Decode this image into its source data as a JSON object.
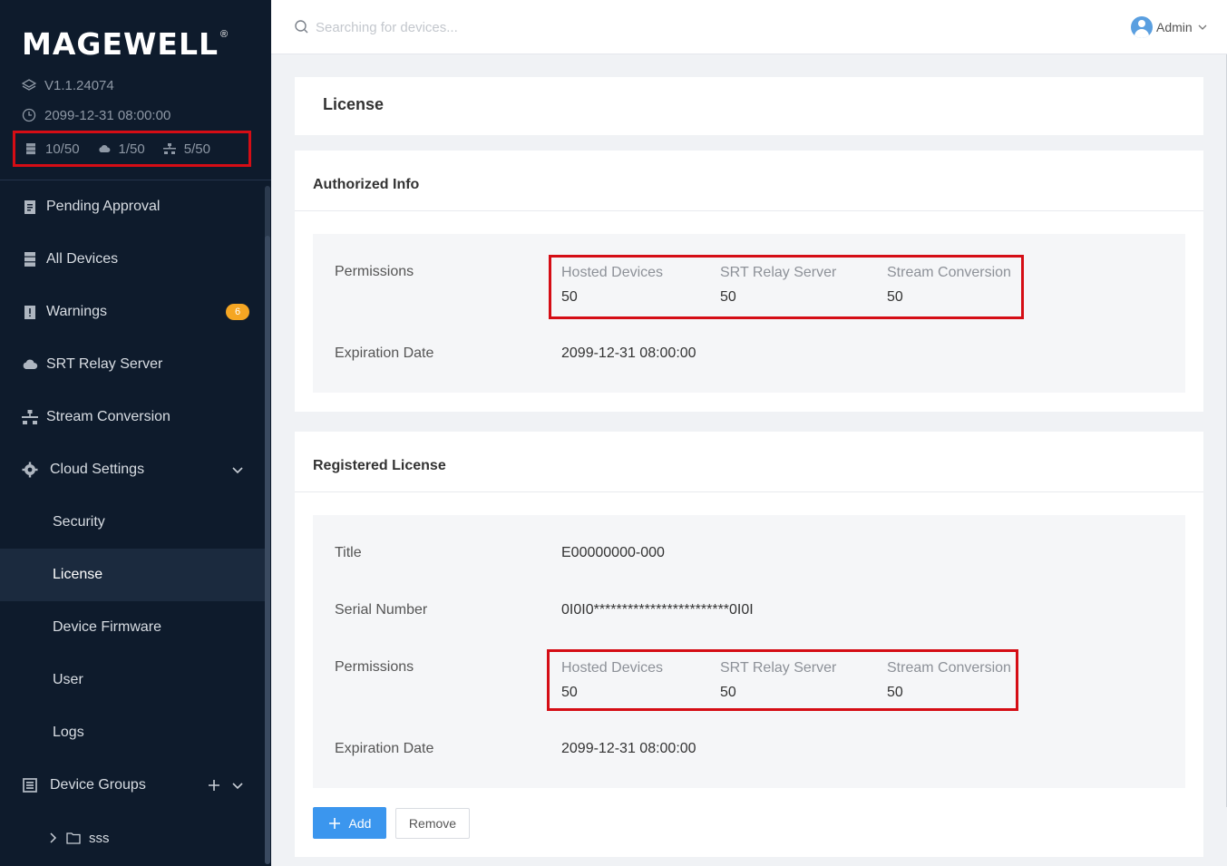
{
  "brand": {
    "logo": "MAGEWELL",
    "registered": "®"
  },
  "sidebar": {
    "version": "V1.1.24074",
    "datetime": "2099-12-31 08:00:00",
    "stats": {
      "devices": "10/50",
      "srt": "1/50",
      "stream": "5/50"
    },
    "nav": {
      "pending": {
        "label": "Pending Approval",
        "icon": "clipboard-icon"
      },
      "all_devices": {
        "label": "All Devices",
        "icon": "server-icon"
      },
      "warnings": {
        "label": "Warnings",
        "icon": "warning-doc-icon",
        "badge": "6"
      },
      "srt": {
        "label": "SRT Relay Server",
        "icon": "cloud-icon"
      },
      "stream": {
        "label": "Stream Conversion",
        "icon": "network-icon"
      },
      "cloud_settings": {
        "label": "Cloud Settings",
        "icon": "gear-icon"
      },
      "security": {
        "label": "Security"
      },
      "license": {
        "label": "License"
      },
      "firmware": {
        "label": "Device Firmware"
      },
      "user": {
        "label": "User"
      },
      "logs": {
        "label": "Logs"
      },
      "device_groups": {
        "label": "Device Groups",
        "icon": "groups-icon"
      },
      "group_sss": {
        "label": "sss"
      }
    }
  },
  "topbar": {
    "search_placeholder": "Searching for devices...",
    "user_name": "Admin"
  },
  "page": {
    "title": "License"
  },
  "authorized": {
    "title": "Authorized Info",
    "permissions_label": "Permissions",
    "perm": {
      "hosted_label": "Hosted Devices",
      "hosted_value": "50",
      "srt_label": "SRT Relay Server",
      "srt_value": "50",
      "stream_label": "Stream Conversion",
      "stream_value": "50"
    },
    "expiration_label": "Expiration Date",
    "expiration_value": "2099-12-31 08:00:00"
  },
  "registered": {
    "title": "Registered License",
    "title_label": "Title",
    "title_value": "E00000000-000",
    "serial_label": "Serial Number",
    "serial_value": "0I0I0************************0I0I",
    "permissions_label": "Permissions",
    "perm": {
      "hosted_label": "Hosted Devices",
      "hosted_value": "50",
      "srt_label": "SRT Relay Server",
      "srt_value": "50",
      "stream_label": "Stream Conversion",
      "stream_value": "50"
    },
    "expiration_label": "Expiration Date",
    "expiration_value": "2099-12-31 08:00:00"
  },
  "actions": {
    "add": "Add",
    "remove": "Remove"
  },
  "colors": {
    "sidebar_bg": "#0e1b2c",
    "accent_blue": "#3b96ee",
    "highlight_red": "#d50d15",
    "badge_orange": "#f5a623"
  }
}
